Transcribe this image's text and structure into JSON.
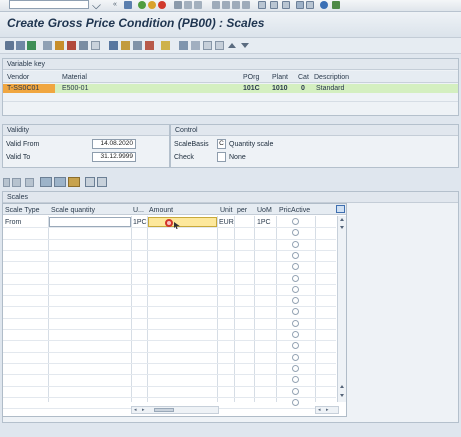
{
  "system_toolbar": {
    "command_field_value": "",
    "icons": [
      "enter-icon",
      "save-icon",
      "back-icon",
      "exit-icon",
      "cancel-icon",
      "print-icon",
      "find-icon",
      "find-next-icon",
      "first-page-icon",
      "previous-page-icon",
      "next-page-icon",
      "last-page-icon",
      "new-session-icon",
      "shortcut-icon",
      "help-icon",
      "customize-layout-icon"
    ]
  },
  "title": "Create Gross Price Condition (PB00) : Scales",
  "variable_key": {
    "section_label": "Variable key",
    "columns": [
      "Vendor",
      "Material",
      "POrg",
      "Plant",
      "Cat",
      "Description"
    ],
    "row": {
      "vendor": "T-SS0C01",
      "material": "E500-01",
      "porg": "101C",
      "plant": "1010",
      "cat": "0",
      "description": "Standard"
    }
  },
  "validity": {
    "section_label": "Validity",
    "valid_from_label": "Valid From",
    "valid_from_value": "14.08.2020",
    "valid_to_label": "Valid To",
    "valid_to_value": "31.12.9999"
  },
  "control": {
    "section_label": "Control",
    "scalebasis_label": "ScaleBasis",
    "scalebasis_code": "C",
    "scalebasis_text": "Quantity scale",
    "check_label": "Check",
    "check_text": "None"
  },
  "scales": {
    "section_label": "Scales",
    "columns": [
      "Scale Type",
      "Scale quantity",
      "U...",
      "Amount",
      "Unit",
      "per",
      "UoM",
      "PricActive"
    ],
    "first_row": {
      "scale_type": "From",
      "scale_quantity": "",
      "uom": "1PC",
      "amount": "",
      "unit": "EUR",
      "per": "",
      "per_uom": "1PC"
    }
  }
}
